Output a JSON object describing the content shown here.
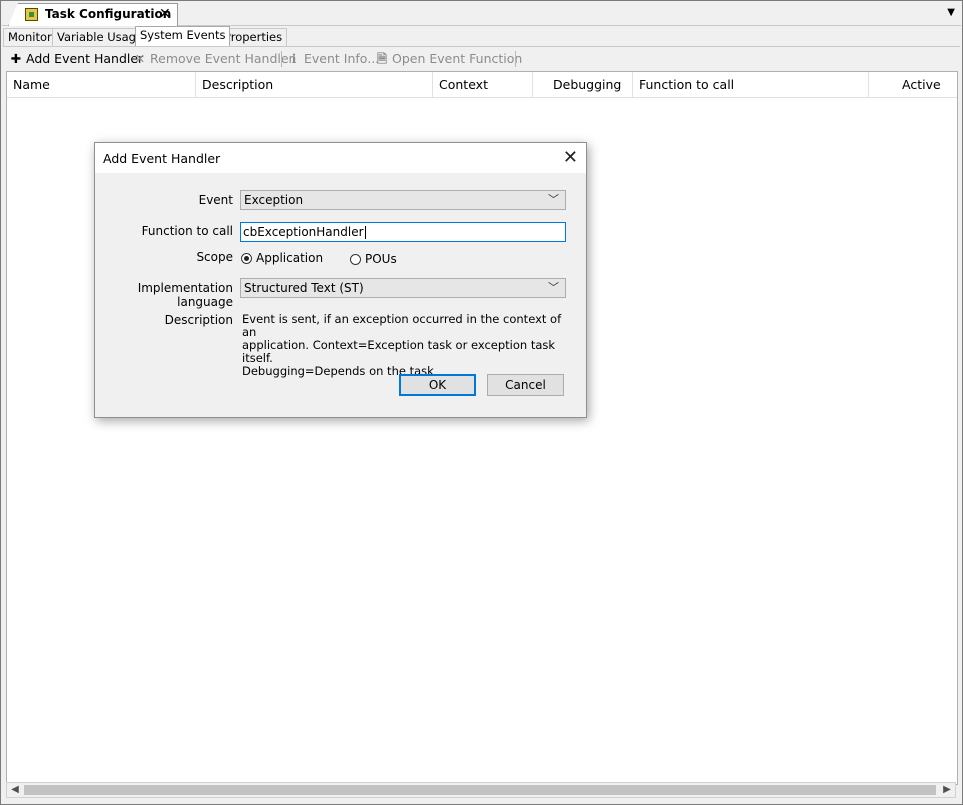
{
  "document_tab": {
    "title": "Task Configuration",
    "close": "✕"
  },
  "sub_tabs": [
    "Monitor",
    "Variable Usage",
    "System Events",
    "Properties"
  ],
  "toolbar": {
    "add": "Add Event Handler",
    "remove": "Remove Event Handler",
    "info": "Event Info...",
    "open": "Open Event Function"
  },
  "grid": {
    "columns": [
      "Name",
      "Description",
      "Context",
      "Debugging",
      "Function to call",
      "Active"
    ]
  },
  "dialog": {
    "title": "Add Event Handler",
    "event_label": "Event",
    "event_value": "Exception",
    "function_label": "Function to call",
    "function_value": "cbExceptionHandler",
    "scope_label": "Scope",
    "scope_options": [
      "Application",
      "POUs"
    ],
    "scope_selected": "Application",
    "language_label": "Implementation language",
    "language_value": "Structured Text (ST)",
    "description_label": "Description",
    "description_lines": [
      "Event is sent, if an exception occurred in the context of an",
      "application. Context=Exception task or exception task itself.",
      "Debugging=Depends on the task"
    ],
    "ok": "OK",
    "cancel": "Cancel"
  }
}
